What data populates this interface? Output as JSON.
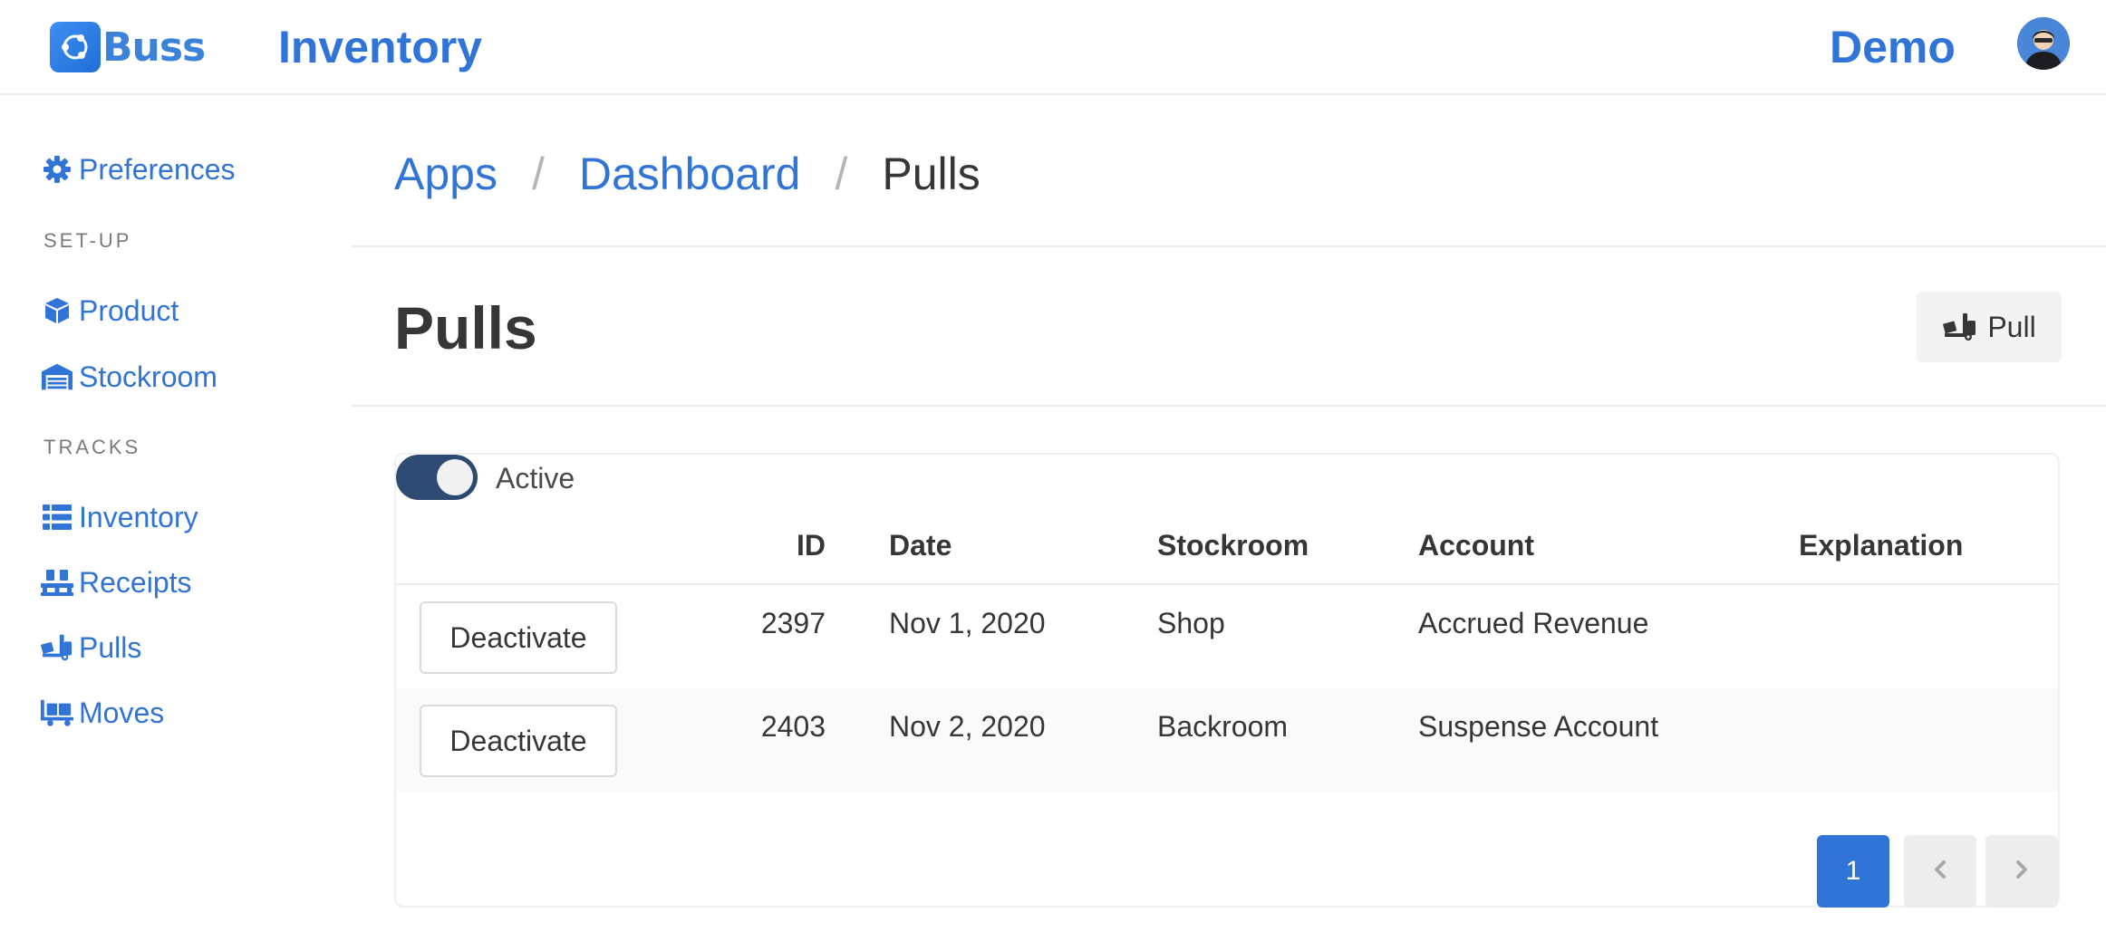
{
  "navbar": {
    "brand": "Buss",
    "app_title": "Inventory",
    "user_name": "Demo"
  },
  "sidebar": {
    "preferences": {
      "label": "Preferences",
      "icon": "gear-icon"
    },
    "sections": [
      {
        "label": "SET-UP",
        "items": [
          {
            "label": "Product",
            "icon": "cube-icon"
          },
          {
            "label": "Stockroom",
            "icon": "warehouse-icon"
          }
        ]
      },
      {
        "label": "TRACKS",
        "items": [
          {
            "label": "Inventory",
            "icon": "list-icon"
          },
          {
            "label": "Receipts",
            "icon": "pallet-icon"
          },
          {
            "label": "Pulls",
            "icon": "dolly-icon"
          },
          {
            "label": "Moves",
            "icon": "cart-flatbed-icon"
          }
        ]
      }
    ]
  },
  "breadcrumb": {
    "items": [
      "Apps",
      "Dashboard"
    ],
    "separator": "/",
    "current": "Pulls"
  },
  "page": {
    "title": "Pulls",
    "pull_button_label": "Pull"
  },
  "filter": {
    "active_label": "Active",
    "active_on": true
  },
  "table": {
    "columns": [
      "ID",
      "Date",
      "Stockroom",
      "Account",
      "Explanation"
    ],
    "rows": [
      {
        "action": "Deactivate",
        "id": "2397",
        "date": "Nov 1, 2020",
        "stockroom": "Shop",
        "account": "Accrued Revenue",
        "explanation": ""
      },
      {
        "action": "Deactivate",
        "id": "2403",
        "date": "Nov 2, 2020",
        "stockroom": "Backroom",
        "account": "Suspense Account",
        "explanation": ""
      }
    ]
  },
  "pagination": {
    "current_page": "1",
    "prev_icon": "chevron-left-icon",
    "next_icon": "chevron-right-icon"
  },
  "colors": {
    "primary": "#3174d8",
    "toggle": "#2d4a73",
    "text": "#363636"
  }
}
